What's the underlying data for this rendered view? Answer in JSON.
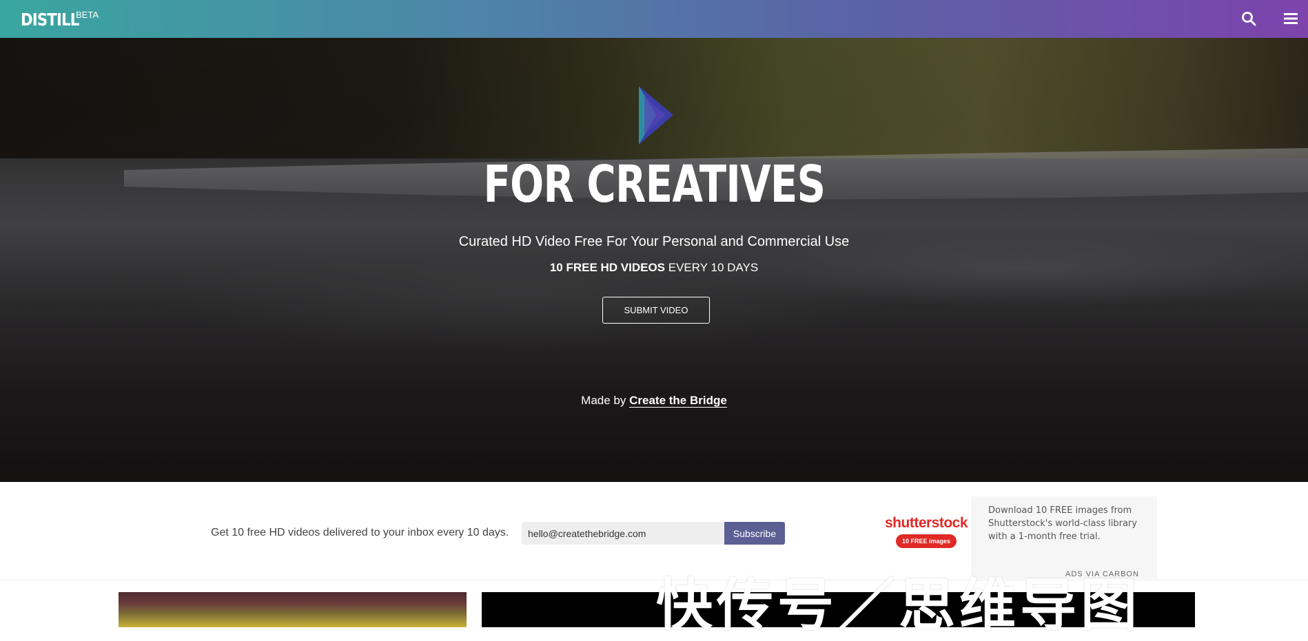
{
  "header": {
    "logo": "DISTILL",
    "logo_badge": "BETA"
  },
  "hero": {
    "title": "FOR CREATIVES",
    "subtitle": "Curated HD Video Free For Your Personal and Commercial Use",
    "tagline_bold": "10 FREE HD VIDEOS",
    "tagline_rest": " EVERY 10 DAYS",
    "submit_label": "SUBMIT VIDEO",
    "made_by_prefix": "Made by ",
    "made_by_link": "Create the Bridge"
  },
  "newsletter": {
    "text": "Get 10 free HD videos delivered to your inbox every 10 days.",
    "email_value": "hello@createthebridge.com",
    "subscribe_label": "Subscribe"
  },
  "ad": {
    "brand": "shutterstock",
    "badge": "10 FREE images",
    "text": "Download 10 FREE images from Shutterstock's world-class library with a 1-month free trial.",
    "via": "ADS VIA CARBON"
  },
  "watermark": "快传号／思维导图",
  "colors": {
    "header_gradient_start": "#3aa6a0",
    "header_gradient_end": "#7d43ad",
    "subscribe_bg": "#5c5f93",
    "shutterstock_red": "#e02a26"
  }
}
